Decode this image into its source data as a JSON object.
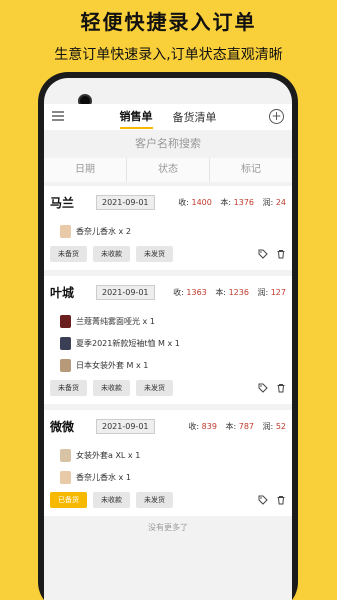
{
  "promo": {
    "title": "轻便快捷录入订单",
    "subtitle": "生意订单快速录入,订单状态直观清晰"
  },
  "header": {
    "tabs": [
      {
        "label": "销售单",
        "active": true
      },
      {
        "label": "备货清单",
        "active": false
      }
    ]
  },
  "search": {
    "placeholder": "客户名称搜索"
  },
  "filters": [
    "日期",
    "状态",
    "标记"
  ],
  "stats_labels": {
    "income": "收:",
    "cost": "本:",
    "profit": "润:"
  },
  "orders": [
    {
      "name": "马兰",
      "date": "2021-09-01",
      "income": "1400",
      "cost": "1376",
      "profit": "24",
      "items": [
        {
          "text": "香奈儿香水 x 2",
          "color": "#e8c9a8"
        }
      ],
      "buttons": [
        {
          "label": "未备货",
          "active": false
        },
        {
          "label": "未收款",
          "active": false
        },
        {
          "label": "未发货",
          "active": false
        }
      ]
    },
    {
      "name": "叶城",
      "date": "2021-09-01",
      "income": "1363",
      "cost": "1236",
      "profit": "127",
      "items": [
        {
          "text": "兰蔻菁纯雾面哑光 x 1",
          "color": "#6b1e1e"
        },
        {
          "text": "夏季2021新款短袖t恤 M x 1",
          "color": "#3a3f55"
        },
        {
          "text": "日本女装外套 M x 1",
          "color": "#b79a7a"
        }
      ],
      "buttons": [
        {
          "label": "未备货",
          "active": false
        },
        {
          "label": "未收款",
          "active": false
        },
        {
          "label": "未发货",
          "active": false
        }
      ]
    },
    {
      "name": "微微",
      "date": "2021-09-01",
      "income": "839",
      "cost": "787",
      "profit": "52",
      "items": [
        {
          "text": "女装外套a XL x 1",
          "color": "#d8c3a5"
        },
        {
          "text": "香奈儿香水 x 1",
          "color": "#e8c9a8"
        }
      ],
      "buttons": [
        {
          "label": "已备货",
          "active": true
        },
        {
          "label": "未收款",
          "active": false
        },
        {
          "label": "未发货",
          "active": false
        }
      ]
    }
  ],
  "footer_text": "没有更多了",
  "colors": {
    "accent": "#f6b900",
    "background": "#f9cf3a",
    "number": "#c0392b"
  }
}
